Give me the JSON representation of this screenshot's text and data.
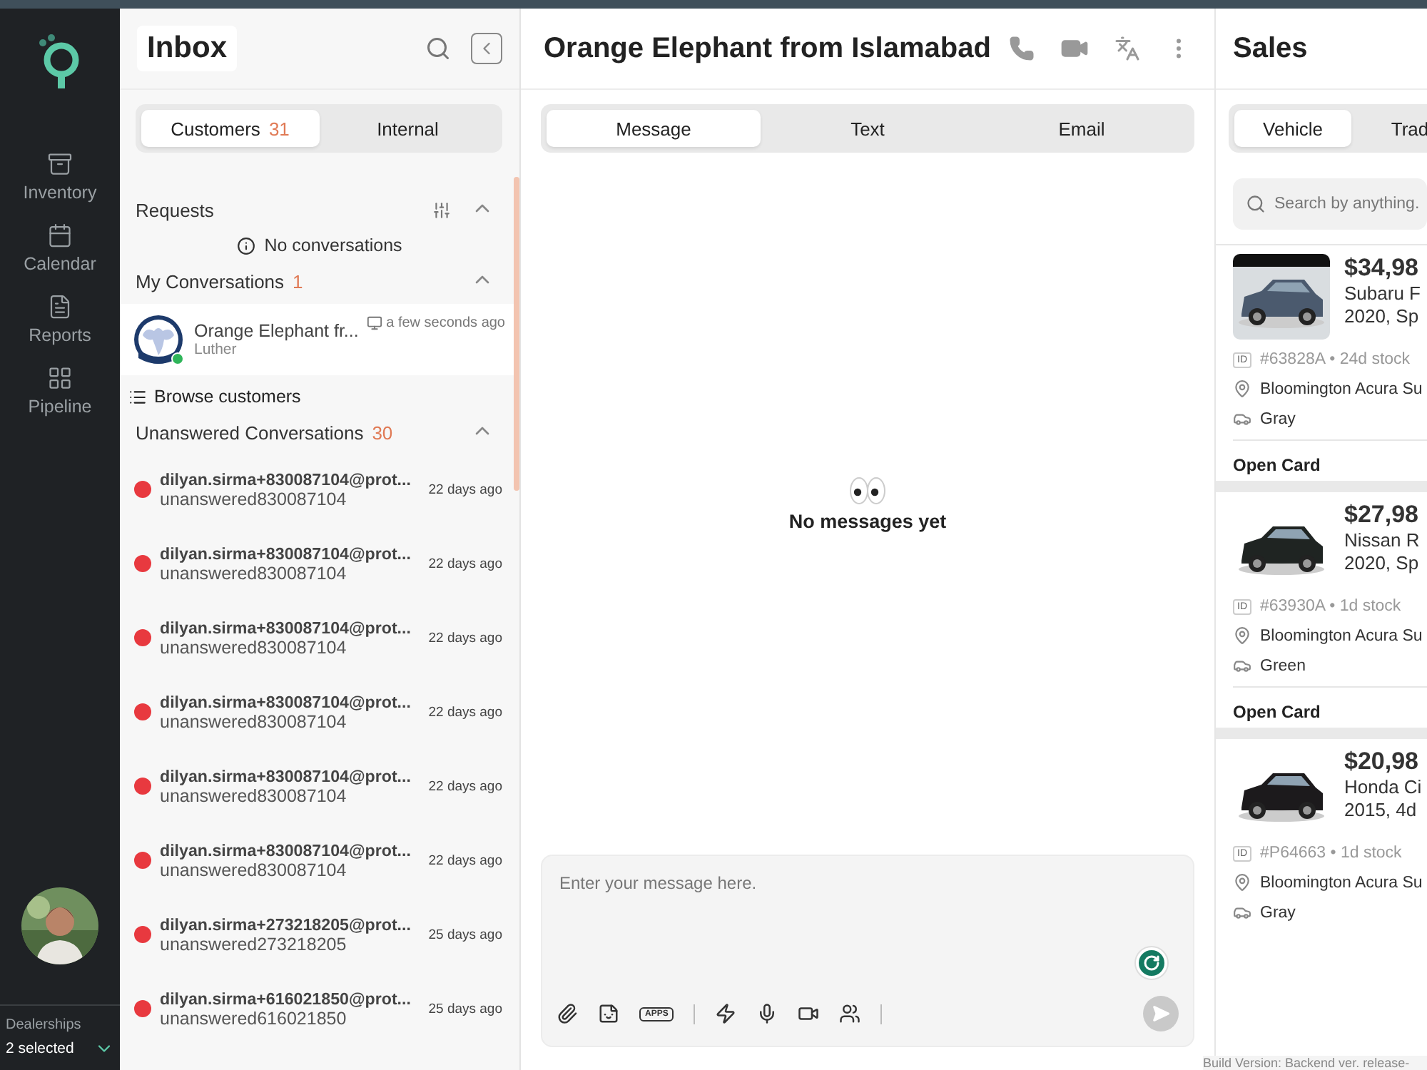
{
  "nav": {
    "items": [
      {
        "label": "Inventory"
      },
      {
        "label": "Calendar"
      },
      {
        "label": "Reports"
      },
      {
        "label": "Pipeline"
      }
    ],
    "dealerships": {
      "label": "Dealerships",
      "value": "2 selected"
    }
  },
  "inbox": {
    "title": "Inbox",
    "tabs": [
      {
        "label": "Customers",
        "count": "31",
        "selected": true
      },
      {
        "label": "Internal",
        "selected": false
      }
    ],
    "requests": {
      "title": "Requests",
      "expanded": true,
      "empty": "No conversations"
    },
    "my_conversations": {
      "title": "My Conversations",
      "count": "1",
      "expanded": true,
      "items": [
        {
          "name": "Orange Elephant fr...",
          "subtitle": "Luther",
          "time": "a few seconds ago",
          "online": true
        }
      ]
    },
    "browse": "Browse customers",
    "unanswered": {
      "title": "Unanswered Conversations",
      "count": "30",
      "expanded": true,
      "items": [
        {
          "name": "dilyan.sirma+830087104@prot...",
          "subtitle": "unanswered830087104",
          "time": "22 days ago"
        },
        {
          "name": "dilyan.sirma+830087104@prot...",
          "subtitle": "unanswered830087104",
          "time": "22 days ago"
        },
        {
          "name": "dilyan.sirma+830087104@prot...",
          "subtitle": "unanswered830087104",
          "time": "22 days ago"
        },
        {
          "name": "dilyan.sirma+830087104@prot...",
          "subtitle": "unanswered830087104",
          "time": "22 days ago"
        },
        {
          "name": "dilyan.sirma+830087104@prot...",
          "subtitle": "unanswered830087104",
          "time": "22 days ago"
        },
        {
          "name": "dilyan.sirma+830087104@prot...",
          "subtitle": "unanswered830087104",
          "time": "22 days ago"
        },
        {
          "name": "dilyan.sirma+273218205@prot...",
          "subtitle": "unanswered273218205",
          "time": "25 days ago"
        },
        {
          "name": "dilyan.sirma+616021850@prot...",
          "subtitle": "unanswered616021850",
          "time": "25 days ago"
        }
      ]
    }
  },
  "chat": {
    "title": "Orange Elephant from Islamabad",
    "tabs": [
      {
        "label": "Message",
        "selected": true
      },
      {
        "label": "Text",
        "selected": false
      },
      {
        "label": "Email",
        "selected": false
      }
    ],
    "empty": "No messages yet",
    "composer": {
      "placeholder": "Enter your message here.",
      "apps_label": "APPS"
    }
  },
  "sales": {
    "title": "Sales",
    "tabs": [
      {
        "label": "Vehicle",
        "selected": true
      },
      {
        "label": "Trad",
        "selected": false
      }
    ],
    "search": {
      "placeholder": "Search by anything."
    },
    "vehicles": [
      {
        "price": "$34,98",
        "model": "Subaru F",
        "trim": "2020, Sp",
        "id_badge": "ID",
        "stock": "#63828A • 24d stock",
        "location": "Bloomington Acura Su",
        "exterior": "Gray",
        "action": "Open Card"
      },
      {
        "price": "$27,98",
        "model": "Nissan R",
        "trim": "2020, Sp",
        "id_badge": "ID",
        "stock": "#63930A • 1d stock",
        "location": "Bloomington Acura Su",
        "exterior": "Green",
        "action": "Open Card"
      },
      {
        "price": "$20,98",
        "model": "Honda Ci",
        "trim": "2015, 4d",
        "id_badge": "ID",
        "stock": "#P64663 • 1d stock",
        "location": "Bloomington Acura Su",
        "exterior": "Gray"
      }
    ]
  },
  "footer": "Build Version: Backend ver. release-"
}
